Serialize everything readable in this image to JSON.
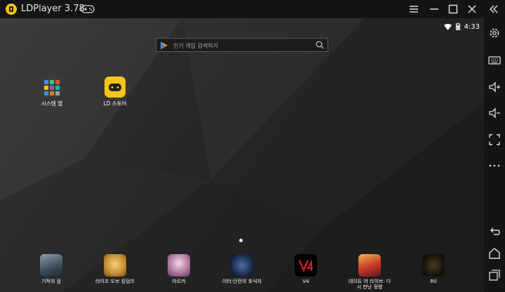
{
  "window": {
    "title": "LDPlayer 3.78"
  },
  "status": {
    "time": "4:33"
  },
  "search": {
    "placeholder": "인기 게임 검색하기"
  },
  "desktop_icons": [
    {
      "label": "시스템 앱"
    },
    {
      "label": "LD 스토어"
    }
  ],
  "dock_apps": [
    {
      "label": "기적의 검"
    },
    {
      "label": "라이즈 오브 킹덤즈"
    },
    {
      "label": "아르카"
    },
    {
      "label": "이터:던전의 포식자"
    },
    {
      "label": "V4"
    },
    {
      "label": "데이트 어 라이브: 다시 만난 정령"
    },
    {
      "label": "R0"
    }
  ],
  "colors": {
    "accent": "#f5c51c",
    "titlebar_bg": "#141414",
    "toolbar_bg": "#141414"
  }
}
